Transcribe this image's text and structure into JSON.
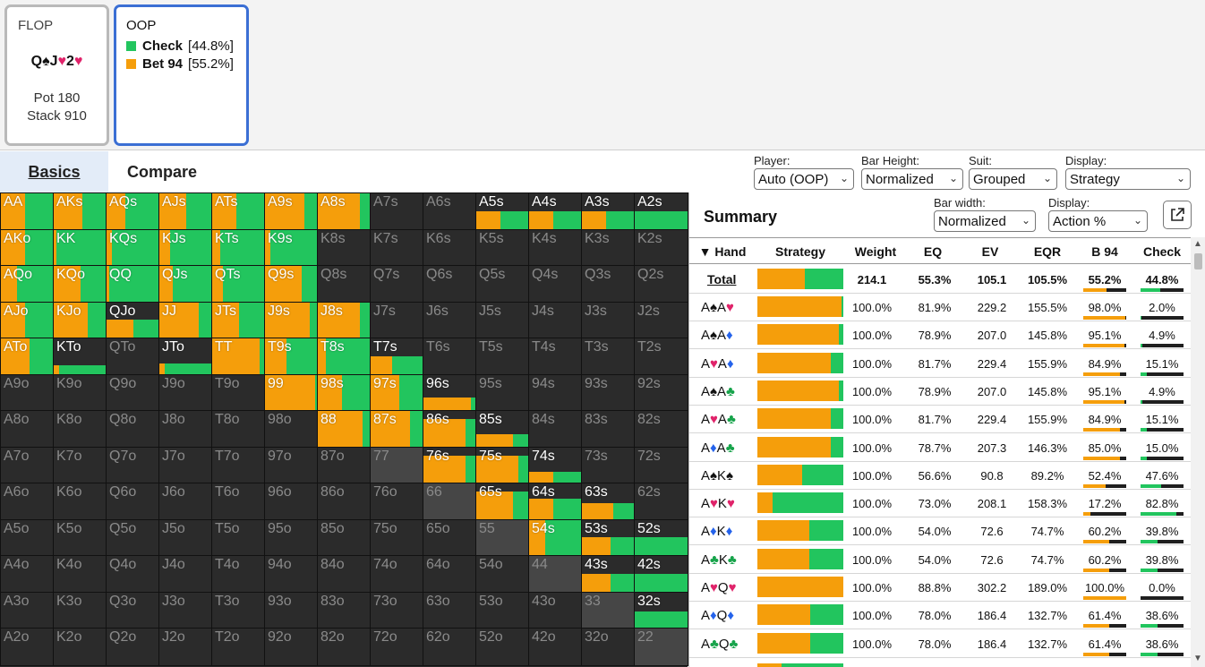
{
  "colors": {
    "check": "#22c55e",
    "bet": "#f59e0b",
    "dark": "#2b2b2b",
    "accent": "#3b6fd4"
  },
  "flop": {
    "title": "FLOP",
    "board": [
      [
        "Q",
        "♠",
        "#111"
      ],
      [
        "J",
        "♥",
        "#e0236a"
      ],
      [
        "2",
        "♥",
        "#e0236a"
      ]
    ],
    "pot": "Pot 180",
    "stack": "Stack 910"
  },
  "oop": {
    "title": "OOP",
    "actions": [
      {
        "name": "Check",
        "pct": "[44.8%]",
        "color": "#22c55e"
      },
      {
        "name": "Bet 94",
        "pct": "[55.2%]",
        "color": "#f59e0b"
      }
    ]
  },
  "tabs": {
    "basics": "Basics",
    "compare": "Compare"
  },
  "controls": {
    "player": {
      "label": "Player:",
      "value": "Auto (OOP)"
    },
    "bar_height": {
      "label": "Bar Height:",
      "value": "Normalized"
    },
    "suit": {
      "label": "Suit:",
      "value": "Grouped"
    },
    "display": {
      "label": "Display:",
      "value": "Strategy"
    },
    "bar_width": {
      "label": "Bar width:",
      "value": "Normalized"
    },
    "display2": {
      "label": "Display:",
      "value": "Action %"
    }
  },
  "summary": {
    "title": "Summary",
    "columns": [
      "▼ Hand",
      "Strategy",
      "Weight",
      "EQ",
      "EV",
      "EQR",
      "B 94",
      "Check"
    ],
    "total": {
      "hand": "Total",
      "bet": 55.2,
      "weight": "214.1",
      "eq": "55.3%",
      "ev": "105.1",
      "eqr": "105.5%",
      "b94": "55.2%",
      "check": "44.8%"
    },
    "rows": [
      {
        "hand": [
          [
            "A",
            "♠",
            "#111"
          ],
          [
            "A",
            "♥",
            "#e0236a"
          ]
        ],
        "bet": 98.0,
        "weight": "100.0%",
        "eq": "81.9%",
        "ev": "229.2",
        "eqr": "155.5%",
        "b94": "98.0%",
        "check": "2.0%"
      },
      {
        "hand": [
          [
            "A",
            "♠",
            "#111"
          ],
          [
            "A",
            "♦",
            "#2563eb"
          ]
        ],
        "bet": 95.1,
        "weight": "100.0%",
        "eq": "78.9%",
        "ev": "207.0",
        "eqr": "145.8%",
        "b94": "95.1%",
        "check": "4.9%"
      },
      {
        "hand": [
          [
            "A",
            "♥",
            "#e0236a"
          ],
          [
            "A",
            "♦",
            "#2563eb"
          ]
        ],
        "bet": 84.9,
        "weight": "100.0%",
        "eq": "81.7%",
        "ev": "229.4",
        "eqr": "155.9%",
        "b94": "84.9%",
        "check": "15.1%"
      },
      {
        "hand": [
          [
            "A",
            "♠",
            "#111"
          ],
          [
            "A",
            "♣",
            "#16a34a"
          ]
        ],
        "bet": 95.1,
        "weight": "100.0%",
        "eq": "78.9%",
        "ev": "207.0",
        "eqr": "145.8%",
        "b94": "95.1%",
        "check": "4.9%"
      },
      {
        "hand": [
          [
            "A",
            "♥",
            "#e0236a"
          ],
          [
            "A",
            "♣",
            "#16a34a"
          ]
        ],
        "bet": 84.9,
        "weight": "100.0%",
        "eq": "81.7%",
        "ev": "229.4",
        "eqr": "155.9%",
        "b94": "84.9%",
        "check": "15.1%"
      },
      {
        "hand": [
          [
            "A",
            "♦",
            "#2563eb"
          ],
          [
            "A",
            "♣",
            "#16a34a"
          ]
        ],
        "bet": 85.0,
        "weight": "100.0%",
        "eq": "78.7%",
        "ev": "207.3",
        "eqr": "146.3%",
        "b94": "85.0%",
        "check": "15.0%"
      },
      {
        "hand": [
          [
            "A",
            "♠",
            "#111"
          ],
          [
            "K",
            "♠",
            "#111"
          ]
        ],
        "bet": 52.4,
        "weight": "100.0%",
        "eq": "56.6%",
        "ev": "90.8",
        "eqr": "89.2%",
        "b94": "52.4%",
        "check": "47.6%"
      },
      {
        "hand": [
          [
            "A",
            "♥",
            "#e0236a"
          ],
          [
            "K",
            "♥",
            "#e0236a"
          ]
        ],
        "bet": 17.2,
        "weight": "100.0%",
        "eq": "73.0%",
        "ev": "208.1",
        "eqr": "158.3%",
        "b94": "17.2%",
        "check": "82.8%"
      },
      {
        "hand": [
          [
            "A",
            "♦",
            "#2563eb"
          ],
          [
            "K",
            "♦",
            "#2563eb"
          ]
        ],
        "bet": 60.2,
        "weight": "100.0%",
        "eq": "54.0%",
        "ev": "72.6",
        "eqr": "74.7%",
        "b94": "60.2%",
        "check": "39.8%"
      },
      {
        "hand": [
          [
            "A",
            "♣",
            "#16a34a"
          ],
          [
            "K",
            "♣",
            "#16a34a"
          ]
        ],
        "bet": 60.2,
        "weight": "100.0%",
        "eq": "54.0%",
        "ev": "72.6",
        "eqr": "74.7%",
        "b94": "60.2%",
        "check": "39.8%"
      },
      {
        "hand": [
          [
            "A",
            "♥",
            "#e0236a"
          ],
          [
            "Q",
            "♥",
            "#e0236a"
          ]
        ],
        "bet": 100.0,
        "weight": "100.0%",
        "eq": "88.8%",
        "ev": "302.2",
        "eqr": "189.0%",
        "b94": "100.0%",
        "check": "0.0%"
      },
      {
        "hand": [
          [
            "A",
            "♦",
            "#2563eb"
          ],
          [
            "Q",
            "♦",
            "#2563eb"
          ]
        ],
        "bet": 61.4,
        "weight": "100.0%",
        "eq": "78.0%",
        "ev": "186.4",
        "eqr": "132.7%",
        "b94": "61.4%",
        "check": "38.6%"
      },
      {
        "hand": [
          [
            "A",
            "♣",
            "#16a34a"
          ],
          [
            "Q",
            "♣",
            "#16a34a"
          ]
        ],
        "bet": 61.4,
        "weight": "100.0%",
        "eq": "78.0%",
        "ev": "186.4",
        "eqr": "132.7%",
        "b94": "61.4%",
        "check": "38.6%"
      }
    ]
  },
  "grid": {
    "rows": [
      [
        [
          "AA",
          1,
          0.55
        ],
        [
          "AKs",
          1,
          0.45
        ],
        [
          "AQs",
          1,
          0.65
        ],
        [
          "AJs",
          1,
          0.5
        ],
        [
          "ATs",
          1,
          0.55
        ],
        [
          "A9s",
          1,
          0.25
        ],
        [
          "A8s",
          1,
          0.2
        ],
        [
          "A7s",
          0,
          0
        ],
        [
          "A6s",
          0,
          0
        ],
        [
          "A5s",
          0.5,
          0.55
        ],
        [
          "A4s",
          0.5,
          0.55
        ],
        [
          "A3s",
          0.5,
          0.55
        ],
        [
          "A2s",
          0.5,
          1
        ]
      ],
      [
        [
          "AKo",
          1,
          0.55
        ],
        [
          "KK",
          1,
          0.95
        ],
        [
          "KQs",
          1,
          0.9
        ],
        [
          "KJs",
          1,
          0.8
        ],
        [
          "KTs",
          1,
          0.85
        ],
        [
          "K9s",
          1,
          0.9
        ],
        [
          "K8s",
          0,
          0
        ],
        [
          "K7s",
          0,
          0
        ],
        [
          "K6s",
          0,
          0
        ],
        [
          "K5s",
          0,
          0
        ],
        [
          "K4s",
          0,
          0
        ],
        [
          "K3s",
          0,
          0
        ],
        [
          "K2s",
          0,
          0
        ]
      ],
      [
        [
          "AQo",
          1,
          0.7
        ],
        [
          "KQo",
          1,
          0.5
        ],
        [
          "QQ",
          1,
          0.95
        ],
        [
          "QJs",
          1,
          0.75
        ],
        [
          "QTs",
          1,
          0.8
        ],
        [
          "Q9s",
          1,
          0.3
        ],
        [
          "Q8s",
          0,
          0
        ],
        [
          "Q7s",
          0,
          0
        ],
        [
          "Q6s",
          0,
          0
        ],
        [
          "Q5s",
          0,
          0
        ],
        [
          "Q4s",
          0,
          0
        ],
        [
          "Q3s",
          0,
          0
        ],
        [
          "Q2s",
          0,
          0
        ]
      ],
      [
        [
          "AJo",
          1,
          0.55
        ],
        [
          "KJo",
          1,
          0.35
        ],
        [
          "QJo",
          0.5,
          0.5
        ],
        [
          "JJ",
          1,
          0.25
        ],
        [
          "JTs",
          1,
          0.5
        ],
        [
          "J9s",
          1,
          0.15
        ],
        [
          "J8s",
          1,
          0.2
        ],
        [
          "J7s",
          0,
          0
        ],
        [
          "J6s",
          0,
          0
        ],
        [
          "J5s",
          0,
          0
        ],
        [
          "J4s",
          0,
          0
        ],
        [
          "J3s",
          0,
          0
        ],
        [
          "J2s",
          0,
          0
        ]
      ],
      [
        [
          "ATo",
          1,
          0.45
        ],
        [
          "KTo",
          0.25,
          0.9
        ],
        [
          "QTo",
          0,
          0
        ],
        [
          "JTo",
          0.3,
          0.9
        ],
        [
          "TT",
          1,
          0.1
        ],
        [
          "T9s",
          1,
          0.6
        ],
        [
          "T8s",
          1,
          0.85
        ],
        [
          "T7s",
          0.5,
          0.6
        ],
        [
          "T6s",
          0,
          0
        ],
        [
          "T5s",
          0,
          0
        ],
        [
          "T4s",
          0,
          0
        ],
        [
          "T3s",
          0,
          0
        ],
        [
          "T2s",
          0,
          0
        ]
      ],
      [
        [
          "A9o",
          0,
          0
        ],
        [
          "K9o",
          0,
          0
        ],
        [
          "Q9o",
          0,
          0
        ],
        [
          "J9o",
          0,
          0
        ],
        [
          "T9o",
          0,
          0
        ],
        [
          "99",
          1,
          0.05
        ],
        [
          "98s",
          1,
          0.55
        ],
        [
          "97s",
          1,
          0.45
        ],
        [
          "96s",
          0.35,
          0.1
        ],
        [
          "95s",
          0,
          0
        ],
        [
          "94s",
          0,
          0
        ],
        [
          "93s",
          0,
          0
        ],
        [
          "92s",
          0,
          0
        ]
      ],
      [
        [
          "A8o",
          0,
          0
        ],
        [
          "K8o",
          0,
          0
        ],
        [
          "Q8o",
          0,
          0
        ],
        [
          "J8o",
          0,
          0
        ],
        [
          "T8o",
          0,
          0
        ],
        [
          "98o",
          0,
          0
        ],
        [
          "88",
          1,
          0.15
        ],
        [
          "87s",
          1,
          0.25
        ],
        [
          "86s",
          0.75,
          0.2
        ],
        [
          "85s",
          0.35,
          0.3
        ],
        [
          "84s",
          0,
          0
        ],
        [
          "83s",
          0,
          0
        ],
        [
          "82s",
          0,
          0
        ]
      ],
      [
        [
          "A7o",
          0,
          0
        ],
        [
          "K7o",
          0,
          0
        ],
        [
          "Q7o",
          0,
          0
        ],
        [
          "J7o",
          0,
          0
        ],
        [
          "T7o",
          0,
          0
        ],
        [
          "97o",
          0,
          0
        ],
        [
          "87o",
          0,
          0
        ],
        [
          "77",
          -1,
          0
        ],
        [
          "76s",
          0.75,
          0.2
        ],
        [
          "75s",
          0.75,
          0.2
        ],
        [
          "74s",
          0.3,
          0.55
        ],
        [
          "73s",
          0,
          0
        ],
        [
          "72s",
          0,
          0
        ]
      ],
      [
        [
          "A6o",
          0,
          0
        ],
        [
          "K6o",
          0,
          0
        ],
        [
          "Q6o",
          0,
          0
        ],
        [
          "J6o",
          0,
          0
        ],
        [
          "T6o",
          0,
          0
        ],
        [
          "96o",
          0,
          0
        ],
        [
          "86o",
          0,
          0
        ],
        [
          "76o",
          0,
          0
        ],
        [
          "66",
          -1,
          0
        ],
        [
          "65s",
          0.75,
          0.3
        ],
        [
          "64s",
          0.55,
          0.55
        ],
        [
          "63s",
          0.45,
          0.4
        ],
        [
          "62s",
          0,
          0
        ]
      ],
      [
        [
          "A5o",
          0,
          0
        ],
        [
          "K5o",
          0,
          0
        ],
        [
          "Q5o",
          0,
          0
        ],
        [
          "J5o",
          0,
          0
        ],
        [
          "T5o",
          0,
          0
        ],
        [
          "95o",
          0,
          0
        ],
        [
          "85o",
          0,
          0
        ],
        [
          "75o",
          0,
          0
        ],
        [
          "65o",
          0,
          0
        ],
        [
          "55",
          -1,
          0
        ],
        [
          "54s",
          1,
          0.7
        ],
        [
          "53s",
          0.5,
          0.45
        ],
        [
          "52s",
          0.5,
          1
        ]
      ],
      [
        [
          "A4o",
          0,
          0
        ],
        [
          "K4o",
          0,
          0
        ],
        [
          "Q4o",
          0,
          0
        ],
        [
          "J4o",
          0,
          0
        ],
        [
          "T4o",
          0,
          0
        ],
        [
          "94o",
          0,
          0
        ],
        [
          "84o",
          0,
          0
        ],
        [
          "74o",
          0,
          0
        ],
        [
          "64o",
          0,
          0
        ],
        [
          "54o",
          0,
          0
        ],
        [
          "44",
          -1,
          0
        ],
        [
          "43s",
          0.5,
          0.45
        ],
        [
          "42s",
          0.5,
          1
        ]
      ],
      [
        [
          "A3o",
          0,
          0
        ],
        [
          "K3o",
          0,
          0
        ],
        [
          "Q3o",
          0,
          0
        ],
        [
          "J3o",
          0,
          0
        ],
        [
          "T3o",
          0,
          0
        ],
        [
          "93o",
          0,
          0
        ],
        [
          "83o",
          0,
          0
        ],
        [
          "73o",
          0,
          0
        ],
        [
          "63o",
          0,
          0
        ],
        [
          "53o",
          0,
          0
        ],
        [
          "43o",
          0,
          0
        ],
        [
          "33",
          -1,
          0
        ],
        [
          "32s",
          0.45,
          1
        ]
      ],
      [
        [
          "A2o",
          0,
          0
        ],
        [
          "K2o",
          0,
          0
        ],
        [
          "Q2o",
          0,
          0
        ],
        [
          "J2o",
          0,
          0
        ],
        [
          "T2o",
          0,
          0
        ],
        [
          "92o",
          0,
          0
        ],
        [
          "82o",
          0,
          0
        ],
        [
          "72o",
          0,
          0
        ],
        [
          "62o",
          0,
          0
        ],
        [
          "52o",
          0,
          0
        ],
        [
          "42o",
          0,
          0
        ],
        [
          "32o",
          0,
          0
        ],
        [
          "22",
          -1,
          0
        ]
      ]
    ]
  }
}
